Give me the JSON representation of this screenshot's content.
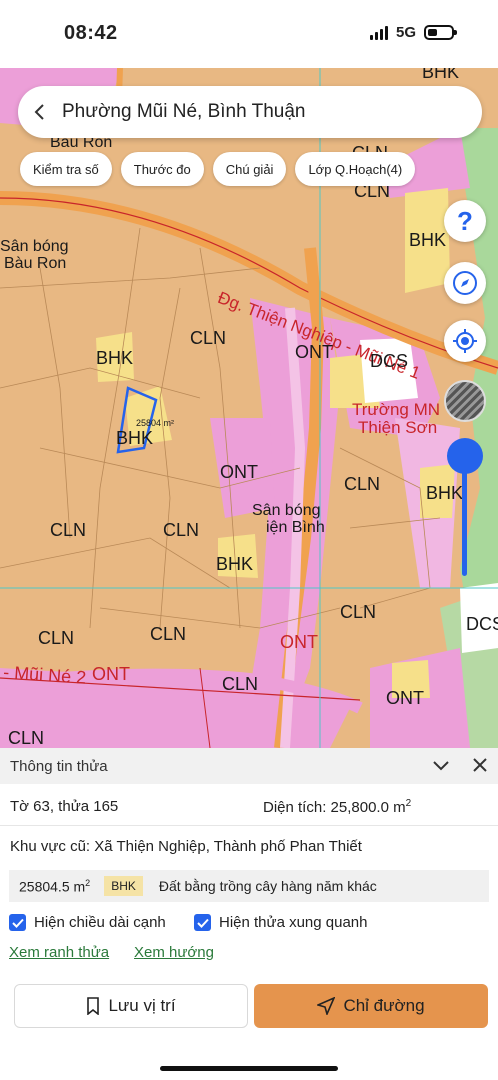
{
  "status": {
    "time": "08:42",
    "network": "5G"
  },
  "search": {
    "title": "Phường Mũi Né, Bình Thuận"
  },
  "chips": [
    "Kiểm tra số",
    "Thước đo",
    "Chú giải",
    "Lớp Q.Hoạch(4)"
  ],
  "map": {
    "labels": {
      "bhk1": "BHK",
      "bhk2": "BHK",
      "bhk3": "BHK",
      "bhk4": "BHK",
      "bhk5": "BHK",
      "cln1": "CLN",
      "cln2": "CLN",
      "cln3": "CLN",
      "cln4": "CLN",
      "cln5": "CLN",
      "cln6": "CLN",
      "cln7": "CLN",
      "cln8": "CLN",
      "cln9": "CLN",
      "cln10": "CLN",
      "ont1": "ONT",
      "ont2": "ONT",
      "ont3": "ONT",
      "ont4": "ONT",
      "ont5": "ONT",
      "dcs1": "DCS",
      "dcs2": "DCS",
      "road1": "Đg. Thiện Nghiệp - Mũi Né 1",
      "road2": "- Mũi Né 2",
      "school1": "Trường MN",
      "school2": "Thiện Sơn",
      "field1a": "Sân bóng",
      "field1b": "Bàu Ron",
      "field2a": "Sân bóng",
      "field2b": "iện Bình",
      "bauron_top": "Bàu Ron",
      "parcel_area": "25804 m²"
    }
  },
  "panel": {
    "title": "Thông tin thửa",
    "sheet": "Tờ 63, thửa 165",
    "area_label": "Diện tích: 25,800.0 m",
    "area_sup": "2",
    "old_area": "Khu vực cũ: Xã Thiện Nghiệp, Thành phố Phan Thiết",
    "land_area": "25804.5 m",
    "land_area_sup": "2",
    "land_code": "BHK",
    "land_desc": "Đất bằng trồng cây hàng năm khác",
    "check1": "Hiện chiều dài cạnh",
    "check2": "Hiện thửa xung quanh",
    "link1": "Xem ranh thửa",
    "link2": "Xem hướng",
    "save_label": "Lưu vị trí",
    "route_label": "Chỉ đường"
  },
  "colors": {
    "accent": "#2563eb",
    "route_button": "#e5944d",
    "cln": "#e8b883",
    "ont": "#ec9fd8",
    "bhk": "#f6e08a",
    "link": "#2b7a3b"
  }
}
